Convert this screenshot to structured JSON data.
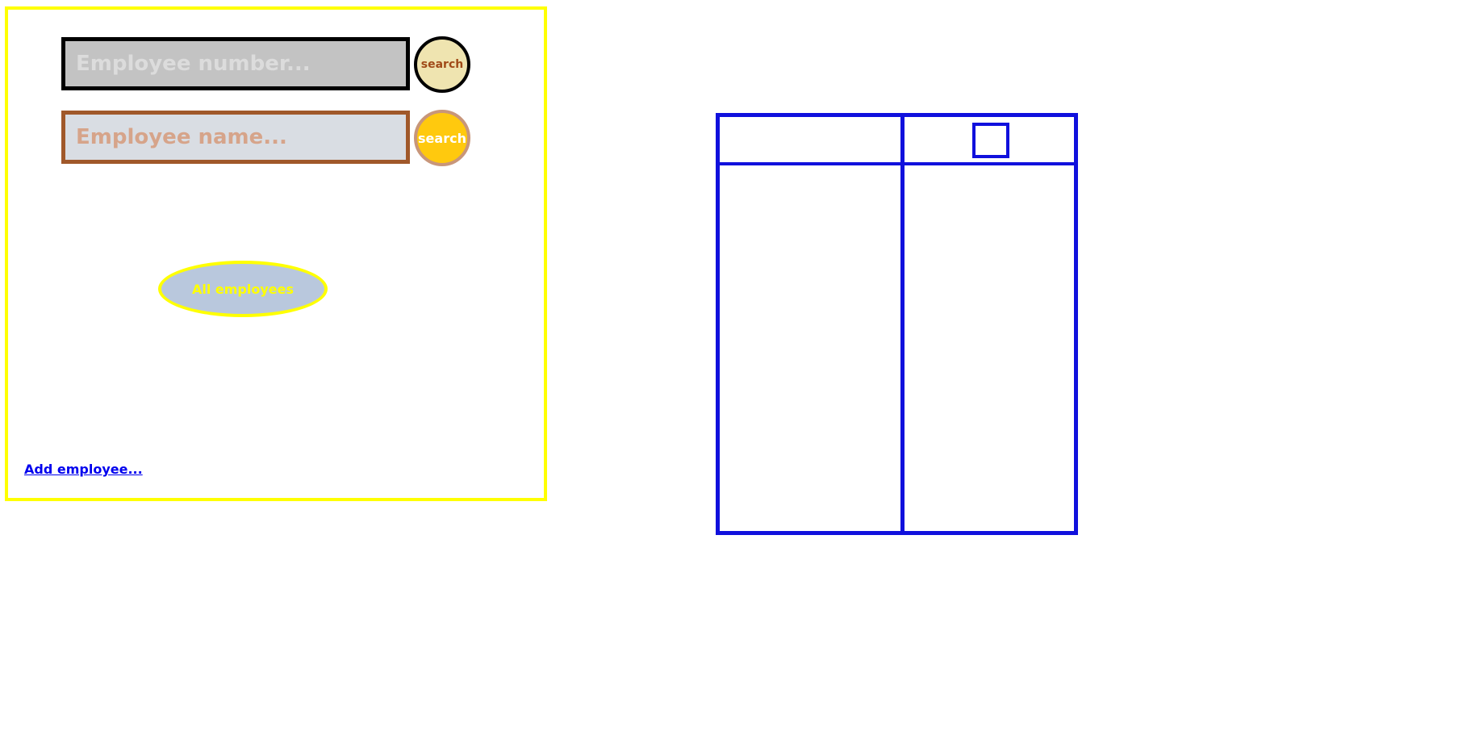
{
  "search_panel": {
    "employee_number_placeholder": "Employee number...",
    "employee_number_search_label": "search",
    "employee_name_placeholder": "Employee name...",
    "employee_name_search_label": "search",
    "all_employees_label": "All employees",
    "add_employee_label": "Add employee..."
  },
  "results_table": {
    "columns": [
      "",
      ""
    ],
    "rows": []
  },
  "colors": {
    "panel_border": "#ffff00",
    "table_border": "#1010dd",
    "link": "#0000ee",
    "search_name_button": "#ffc90e",
    "search_number_button": "#efe4b0",
    "all_employees_button": "#b9c8dd"
  }
}
